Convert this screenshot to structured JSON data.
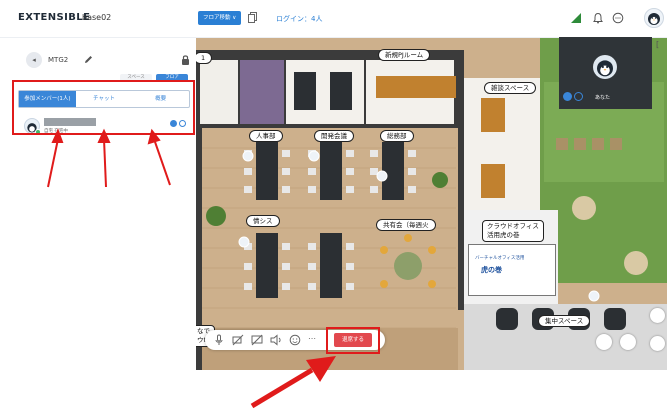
{
  "header": {
    "logo": "EXTENSIBLE",
    "workspace": "base02",
    "floor_button": "フロア移動 ∨",
    "login_count": "ログイン：4人"
  },
  "sidebar": {
    "room_name": "MTG2",
    "mini_tabs": [
      "スペース",
      "フロア"
    ],
    "tabs": [
      "参加メンバー(1人)",
      "チャット",
      "概要"
    ],
    "member_status": "自宅 在宅中"
  },
  "map": {
    "labels": {
      "partial_top_left": "1",
      "new_pj_room": "新規PJルーム",
      "chat_space": "雑談スペース",
      "hr": "人事部",
      "dev_meeting": "開発会議",
      "general_affairs": "総務部",
      "info_sys": "情シス",
      "sharing": "共有会（毎週火",
      "cloud_office_1": "クラウドオフィス",
      "cloud_office_2": "活用虎の巻",
      "focus_space": "集中スペース",
      "partial_left_1": "なで",
      "partial_left_2": "ウt"
    },
    "screen_title": "バーチャルオフィス活用",
    "screen_main": "虎の巻"
  },
  "camera": {
    "name": "あなた"
  },
  "bottom_bar": {
    "leave_label": "退席する"
  },
  "colors": {
    "accent": "#3a86d8",
    "highlight": "#e01b1b",
    "leave": "#e2484e",
    "floor": "#cdb08c",
    "room_floor": "#f3f1ec",
    "table": "#2b2f33",
    "grass": "#6f9e4a"
  }
}
